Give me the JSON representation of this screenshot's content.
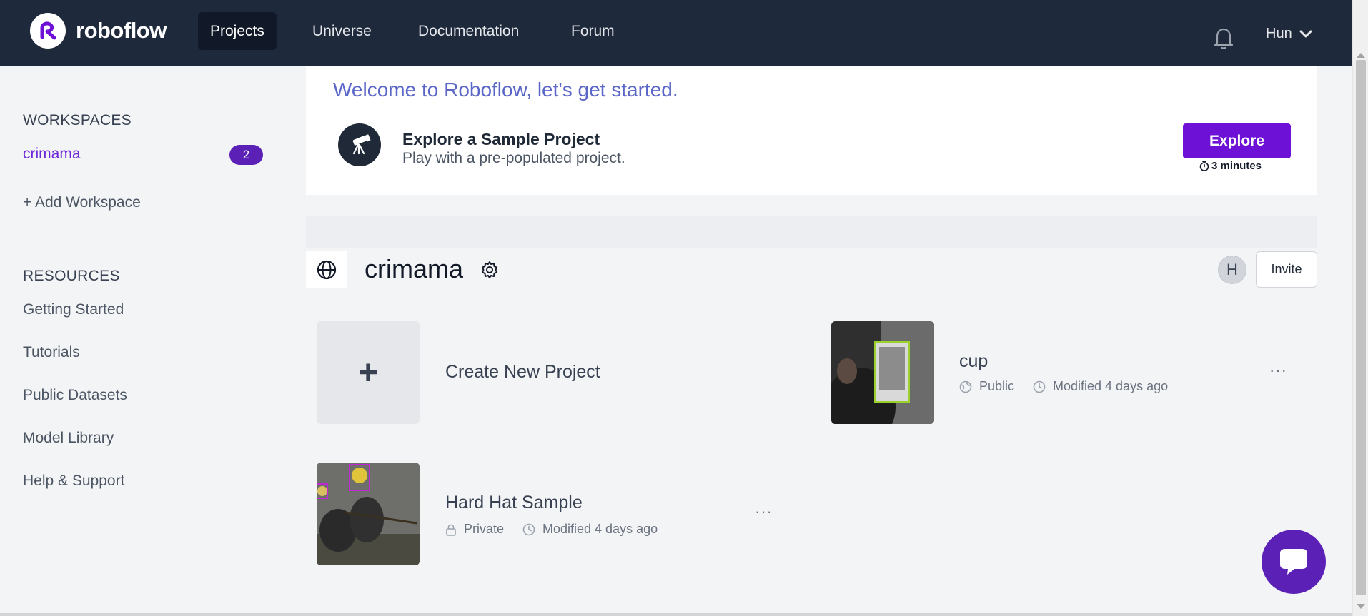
{
  "nav": {
    "brand": "roboflow",
    "items": [
      {
        "label": "Projects",
        "active": true
      },
      {
        "label": "Universe",
        "active": false
      },
      {
        "label": "Documentation",
        "active": false
      },
      {
        "label": "Forum",
        "active": false
      }
    ],
    "user": "Hun"
  },
  "sidebar": {
    "workspaces_heading": "WORKSPACES",
    "workspace": {
      "name": "crimama",
      "count": "2"
    },
    "add_workspace": "+ Add Workspace",
    "resources_heading": "RESOURCES",
    "resources": [
      "Getting Started",
      "Tutorials",
      "Public Datasets",
      "Model Library",
      "Help & Support"
    ]
  },
  "welcome": {
    "title": "Welcome to Roboflow, let's get started.",
    "sample_title": "Explore a Sample Project",
    "sample_subtitle": "Play with a pre-populated project.",
    "explore_label": "Explore",
    "explore_time": "3 minutes"
  },
  "workspace_header": {
    "name": "crimama",
    "avatar_initial": "H",
    "invite_label": "Invite"
  },
  "projects": {
    "create_label": "Create New Project",
    "create_symbol": "+",
    "items": [
      {
        "name": "cup",
        "visibility": "Public",
        "modified": "Modified 4 days ago"
      },
      {
        "name": "Hard Hat Sample",
        "visibility": "Private",
        "modified": "Modified 4 days ago"
      }
    ],
    "more_label": "···"
  },
  "colors": {
    "nav_bg": "#1e293b",
    "accent": "#6d11d6",
    "workspace_link": "#6d28d9",
    "welcome_title": "#5b67c7"
  },
  "icons": [
    "bell-icon",
    "chevron-down-icon",
    "telescope-icon",
    "stopwatch-icon",
    "globe-icon",
    "gear-icon",
    "clock-icon",
    "lock-icon",
    "chat-icon"
  ]
}
